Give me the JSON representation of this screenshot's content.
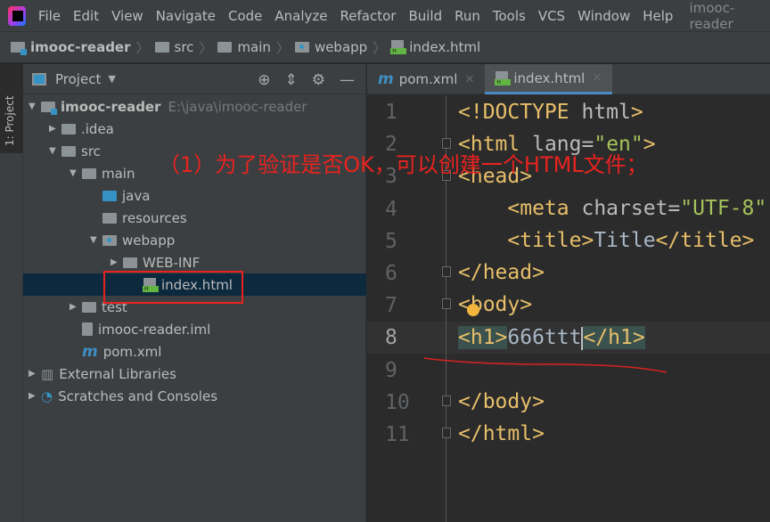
{
  "menubar": {
    "items": [
      "File",
      "Edit",
      "View",
      "Navigate",
      "Code",
      "Analyze",
      "Refactor",
      "Build",
      "Run",
      "Tools",
      "VCS",
      "Window",
      "Help"
    ],
    "title": "imooc-reader"
  },
  "breadcrumb": [
    "imooc-reader",
    "src",
    "main",
    "webapp",
    "index.html"
  ],
  "sidestrip": {
    "tab": "1: Project"
  },
  "project": {
    "title": "Project",
    "tree": [
      {
        "label": "imooc-reader",
        "hint": "E:\\java\\imooc-reader",
        "depth": 0,
        "arrow": "▼",
        "icon": "module-folder-icon",
        "bold": true
      },
      {
        "label": ".idea",
        "depth": 1,
        "arrow": "▶",
        "icon": "folder-icon"
      },
      {
        "label": "src",
        "depth": 1,
        "arrow": "▼",
        "icon": "folder-icon"
      },
      {
        "label": "main",
        "depth": 2,
        "arrow": "▼",
        "icon": "folder-icon"
      },
      {
        "label": "java",
        "depth": 3,
        "arrow": "",
        "icon": "source-folder-icon"
      },
      {
        "label": "resources",
        "depth": 3,
        "arrow": "",
        "icon": "resources-folder-icon"
      },
      {
        "label": "webapp",
        "depth": 3,
        "arrow": "▼",
        "icon": "web-folder-icon"
      },
      {
        "label": "WEB-INF",
        "depth": 4,
        "arrow": "▶",
        "icon": "folder-icon"
      },
      {
        "label": "index.html",
        "depth": 5,
        "arrow": "",
        "icon": "html-file-icon",
        "selected": true
      },
      {
        "label": "test",
        "depth": 2,
        "arrow": "▶",
        "icon": "folder-icon"
      },
      {
        "label": "imooc-reader.iml",
        "depth": 2,
        "arrow": "",
        "icon": "iml-file-icon"
      },
      {
        "label": "pom.xml",
        "depth": 2,
        "arrow": "",
        "icon": "maven-icon"
      },
      {
        "label": "External Libraries",
        "depth": 0,
        "arrow": "▶",
        "icon": "library-icon"
      },
      {
        "label": "Scratches and Consoles",
        "depth": 0,
        "arrow": "▶",
        "icon": "scratches-icon"
      }
    ]
  },
  "tabs": [
    {
      "label": "pom.xml",
      "icon": "maven-icon"
    },
    {
      "label": "index.html",
      "icon": "html-file-icon",
      "active": true
    }
  ],
  "editor": {
    "lines": [
      "1",
      "2",
      "3",
      "4",
      "5",
      "6",
      "7",
      "8",
      "9",
      "10",
      "11"
    ],
    "current_line": 8,
    "code": {
      "l1a": "<!DOCTYPE ",
      "l1b": "html",
      "l1c": ">",
      "l2a": "<html ",
      "l2b": "lang",
      "l2c": "=",
      "l2d": "\"en\"",
      "l2e": ">",
      "l3": "<head>",
      "l4a": "    <meta ",
      "l4b": "charset",
      "l4c": "=",
      "l4d": "\"UTF-8\"",
      "l5a": "    <title>",
      "l5b": "Title",
      "l5c": "</title>",
      "l6": "</head>",
      "l7": "<body>",
      "l8a": "<h1>",
      "l8b": "666ttt",
      "l8c": "</h1>",
      "l10": "</body>",
      "l11": "</html>"
    }
  },
  "annotation": {
    "text": "（1）为了验证是否OK，可以创建一个HTML文件；",
    "color": "#e8231f"
  }
}
